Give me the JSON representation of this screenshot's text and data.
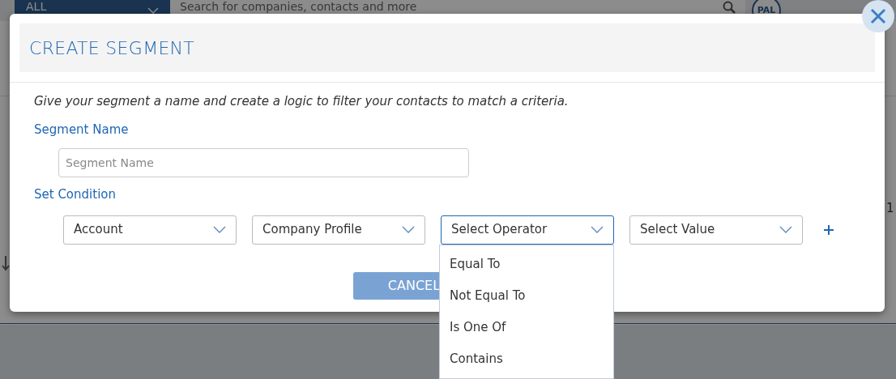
{
  "background": {
    "scope_select": "ALL",
    "search": {
      "placeholder": "Search for companies, contacts and more"
    },
    "avatar": "PAL",
    "edge_texts": [
      {
        "text": "1",
        "kind": "plain"
      }
    ]
  },
  "modal": {
    "title": "CREATE SEGMENT",
    "description": "Give your segment a name and create a logic to filter your contacts to match a criteria.",
    "segment_name": {
      "label": "Segment Name",
      "placeholder": "Segment Name"
    },
    "condition": {
      "label": "Set Condition",
      "selects": [
        {
          "value": "Account",
          "expanded": false
        },
        {
          "value": "Company Profile",
          "expanded": false
        },
        {
          "value": "Select Operator",
          "expanded": true,
          "options": [
            "Equal To",
            "Not Equal To",
            "Is One Of",
            "Contains"
          ]
        },
        {
          "value": "Select Value",
          "expanded": false
        }
      ]
    },
    "buttons": [
      {
        "label": "CANCEL"
      }
    ]
  }
}
